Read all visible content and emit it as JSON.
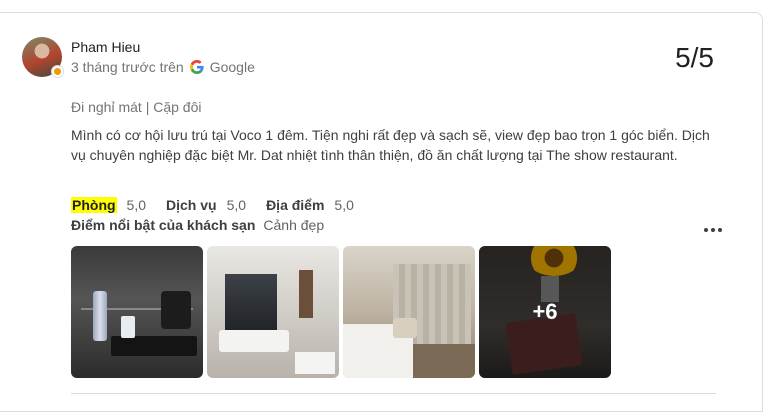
{
  "review": {
    "author": "Pham Hieu",
    "time": "3 tháng trước trên",
    "source": "Google",
    "score": "5/5",
    "trip_type": "Đi nghỉ mát | Cặp đôi",
    "text": "Mình có cơ hội lưu trú tại Voco 1 đêm. Tiện nghi rất đẹp và sạch sẽ, view đẹp bao trọn 1 góc biển. Dịch vụ chuyên nghiệp đặc biệt Mr. Dat nhiệt tình thân thiện, đồ ăn chất lượng tại The show restaurant.",
    "ratings": [
      {
        "label": "Phòng",
        "value": "5,0",
        "highlighted": true
      },
      {
        "label": "Dịch vụ",
        "value": "5,0",
        "highlighted": false
      },
      {
        "label": "Địa điểm",
        "value": "5,0",
        "highlighted": false
      }
    ],
    "highlights_label": "Điểm nổi bật của khách sạn",
    "highlights_value": "Cảnh đẹp",
    "more_photos": "+6"
  },
  "icons": {
    "source_icon": "google-g-icon",
    "menu_icon": "more-vert-icon",
    "badge_icon": "local-guide-badge-icon"
  },
  "colors": {
    "highlight": "#ffff00",
    "secondary_text": "#70757a",
    "border": "#dadce0"
  }
}
